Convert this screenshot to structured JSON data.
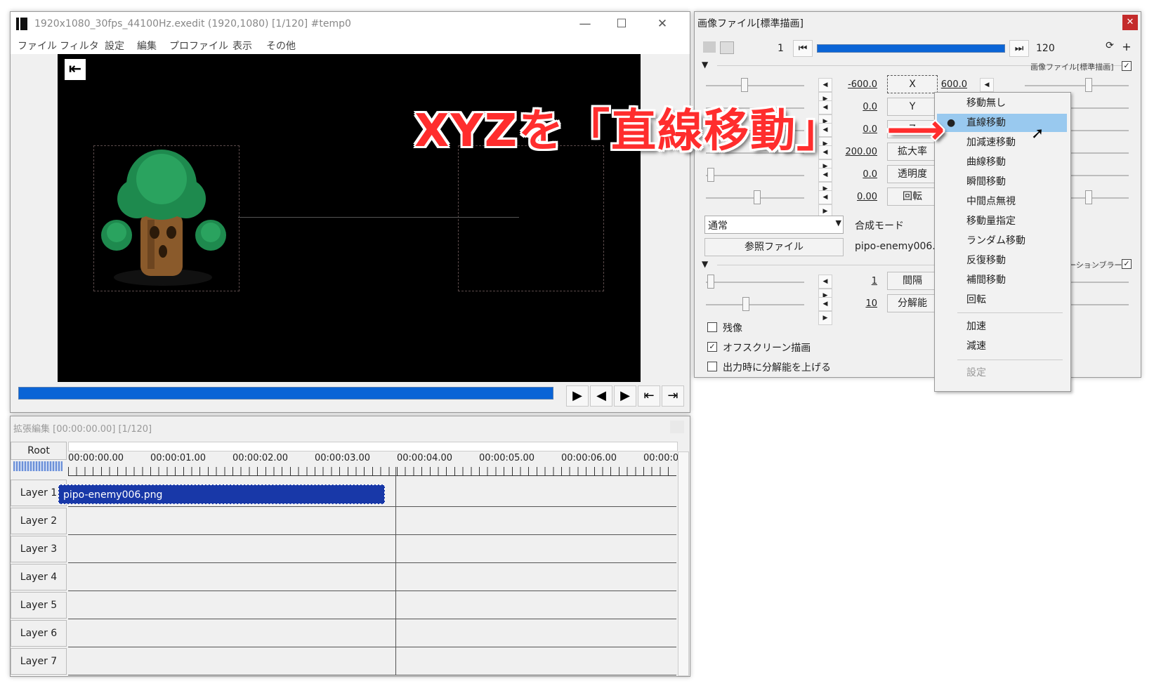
{
  "main_window": {
    "title": "1920x1080_30fps_44100Hz.exedit (1920,1080)  [1/120]  #temp0",
    "menu": [
      "ファイル",
      "フィルタ",
      "設定",
      "編集",
      "プロファイル",
      "表示",
      "その他"
    ]
  },
  "timeline": {
    "title": "拡張編集 [00:00:00.00] [1/120]",
    "root_label": "Root",
    "time_labels": [
      "00:00:00.00",
      "00:00:01.00",
      "00:00:02.00",
      "00:00:03.00",
      "00:00:04.00",
      "00:00:05.00",
      "00:00:06.00",
      "00:00:0"
    ],
    "layers": [
      "Layer 1",
      "Layer 2",
      "Layer 3",
      "Layer 4",
      "Layer 5",
      "Layer 6",
      "Layer 7"
    ],
    "clip_label": "pipo-enemy006.png"
  },
  "props": {
    "title": "画像ファイル[標準描画]",
    "frame_start": "1",
    "frame_end": "120",
    "filter_label": "画像ファイル[標準描画]",
    "rows": [
      {
        "left": "-600.0",
        "button": "X",
        "right": "600.0"
      },
      {
        "left": "0.0",
        "button": "Y",
        "right": ""
      },
      {
        "left": "0.0",
        "button": "Z",
        "right": ""
      },
      {
        "left": "200.00",
        "button": "拡大率",
        "right": ""
      },
      {
        "left": "0.0",
        "button": "透明度",
        "right": ""
      },
      {
        "left": "0.00",
        "button": "回転",
        "right": ""
      }
    ],
    "blend_select": "通常",
    "blend_label": "合成モード",
    "ref_button": "参照ファイル",
    "ref_file": "pipo-enemy006.p",
    "motion_blur_label": "ーションブラー",
    "rows2": [
      {
        "left": "1",
        "button": "間隔"
      },
      {
        "left": "10",
        "button": "分解能"
      }
    ],
    "checks": [
      {
        "label": "残像",
        "checked": false
      },
      {
        "label": "オフスクリーン描画",
        "checked": true
      },
      {
        "label": "出力時に分解能を上げる",
        "checked": false
      }
    ]
  },
  "context_menu": {
    "items": [
      "移動無し",
      "直線移動",
      "加減速移動",
      "曲線移動",
      "瞬間移動",
      "中間点無視",
      "移動量指定",
      "ランダム移動",
      "反復移動",
      "補間移動",
      "回転"
    ],
    "extra": [
      "加速",
      "減速"
    ],
    "disabled": "設定",
    "selected_index": 1
  },
  "annotation": {
    "text": "XYZを「直線移動」",
    "arrow": "⟶"
  }
}
